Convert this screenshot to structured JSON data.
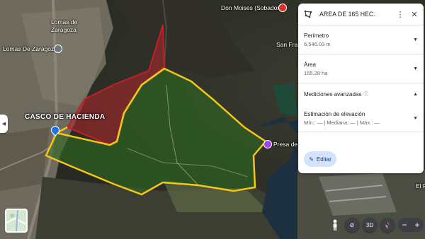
{
  "map": {
    "labels": {
      "lomas_de_zaragoza_a": "Lomas de",
      "lomas_de_zaragoza_b": "Zaragoza",
      "lomas_de_zaragoza_2": "Lomas De Zaragoza",
      "casco": "CASCO DE HACIENDA",
      "don_moises": "Don Moises (Sobador)",
      "san_fra": "San Fra",
      "presa": "Presa de",
      "el_p": "El P"
    },
    "polygon_colors": {
      "red_fill": "#b3262b",
      "green_fill": "#2e6b1f",
      "outline": "#f5c518"
    }
  },
  "panel": {
    "title": "AREA DE 165 HEC.",
    "perimeter_label": "Perímetro",
    "perimeter_value": "6,546.03 m",
    "area_label": "Área",
    "area_value": "165.28 ha",
    "advanced_label": "Mediciones avanzadas",
    "advanced_info_icon": "ⓘ",
    "elevation_label": "Estimación de elevación",
    "elevation_value": "Mín.: — | Mediana: — | Máx.: —",
    "edit_label": "Editar"
  },
  "controls": {
    "btn_3d": "3D",
    "zoom_out": "−",
    "zoom_in": "+"
  },
  "icons": {
    "panel_shape_icon": "polygon-icon",
    "more_icon": "more-vert-icon",
    "close_icon": "close-icon",
    "pencil_icon": "pencil-icon"
  }
}
